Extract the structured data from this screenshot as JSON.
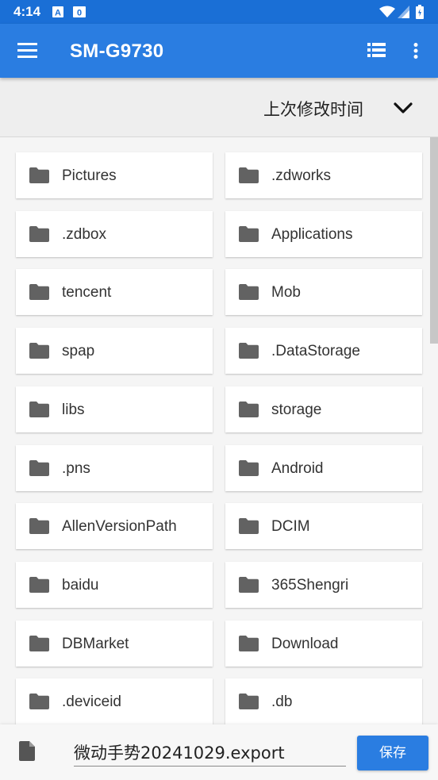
{
  "status_bar": {
    "time": "4:14",
    "notif_a": "A",
    "notif_b": "0"
  },
  "app_bar": {
    "title": "SM-G9730"
  },
  "sort_bar": {
    "label": "上次修改时间"
  },
  "folders": [
    "Pictures",
    ".zdworks",
    ".zdbox",
    "Applications",
    "tencent",
    "Mob",
    "spap",
    ".DataStorage",
    "libs",
    "storage",
    ".pns",
    "Android",
    "AllenVersionPath",
    "DCIM",
    "baidu",
    "365Shengri",
    "DBMarket",
    "Download",
    ".deviceid",
    ".db"
  ],
  "save_bar": {
    "filename": "微动手势20241029.export",
    "save_label": "保存"
  },
  "colors": {
    "primary": "#2a7de1",
    "status": "#1a6fd6",
    "folder_icon": "#606060"
  }
}
